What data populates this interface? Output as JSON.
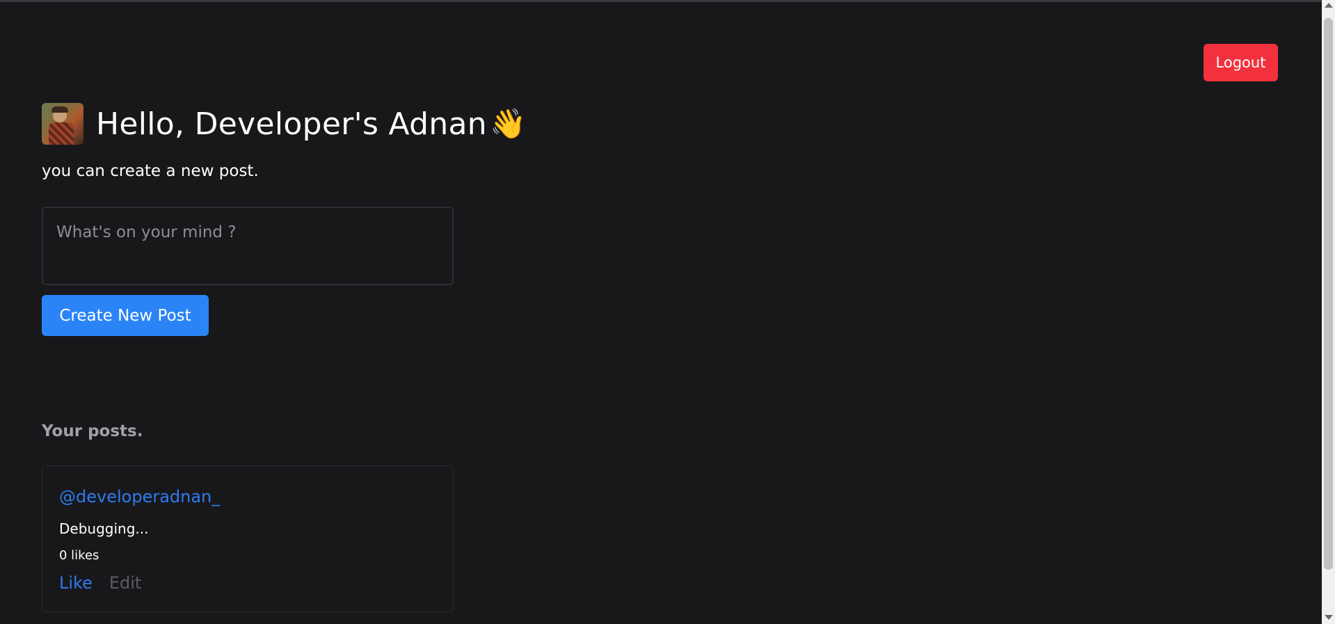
{
  "header": {
    "logout_label": "Logout"
  },
  "greeting": {
    "text": "Hello, Developer's Adnan",
    "emoji": "👋"
  },
  "composer": {
    "subtitle": "you can create a new post.",
    "placeholder": "What's on your mind ?",
    "value": "",
    "submit_label": "Create New Post"
  },
  "posts_section": {
    "title": "Your posts.",
    "posts": [
      {
        "username": "@developeradnan_",
        "content": "Debugging...",
        "likes": "0 likes",
        "like_label": "Like",
        "edit_label": "Edit"
      }
    ]
  },
  "colors": {
    "background": "#18181b",
    "logout": "#f2313d",
    "primary": "#2a84f5",
    "link": "#2f7bef",
    "muted": "#a1a1aa"
  }
}
